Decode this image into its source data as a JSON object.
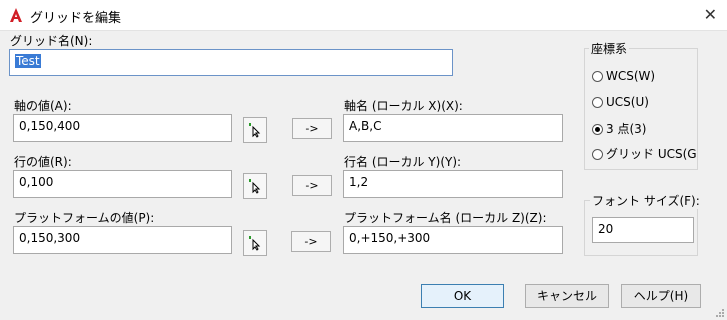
{
  "window": {
    "title": "グリッドを編集",
    "close": "✕"
  },
  "grid_name": {
    "label": "グリッド名(N):",
    "value": "Test"
  },
  "axis": {
    "label": "軸の値(A):",
    "value": "0,150,400",
    "name_label": "軸名 (ローカル X)(X):",
    "name_value": "A,B,C"
  },
  "row": {
    "label": "行の値(R):",
    "value": "0,100",
    "name_label": "行名 (ローカル Y)(Y):",
    "name_value": "1,2"
  },
  "platform": {
    "label": "プラットフォームの値(P):",
    "value": "0,150,300",
    "name_label": "プラットフォーム名 (ローカル Z)(Z):",
    "name_value": "0,+150,+300"
  },
  "arrow_label": "->",
  "coord_system": {
    "label": "座標系",
    "options": [
      {
        "label": "WCS(W)",
        "selected": false
      },
      {
        "label": "UCS(U)",
        "selected": false
      },
      {
        "label": "3 点(3)",
        "selected": true
      },
      {
        "label": "グリッド UCS(G",
        "selected": false
      }
    ]
  },
  "font_size": {
    "label": "フォント サイズ(F):",
    "value": "20"
  },
  "buttons": {
    "ok": "OK",
    "cancel": "キャンセル",
    "help": "ヘルプ(H)"
  },
  "colors": {
    "app_icon": "#d11e26",
    "selection": "#3a7bd5",
    "default_border": "#3c7fb1"
  }
}
